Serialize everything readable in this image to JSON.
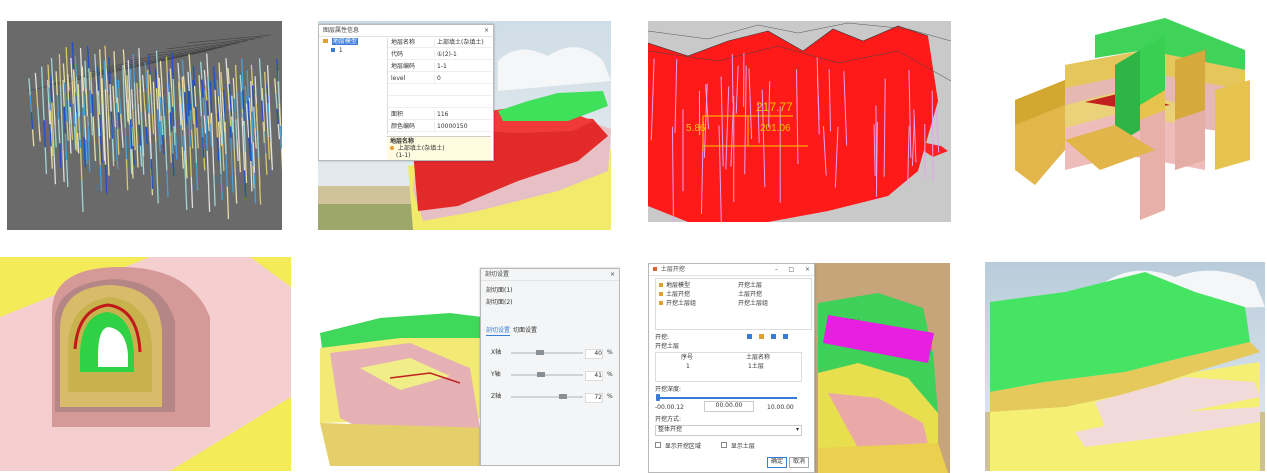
{
  "dialog_props": {
    "title": "图层属性信息",
    "close": "×",
    "tree": [
      "地层模型",
      "1"
    ],
    "rows": [
      {
        "k": "地层名称",
        "v": "上部填土(杂填土)"
      },
      {
        "k": "代码",
        "v": "①(2)-1"
      },
      {
        "k": "地层编码",
        "v": "1-1"
      },
      {
        "k": "level",
        "v": "0"
      },
      {
        "k": "",
        "v": ""
      },
      {
        "k": "",
        "v": ""
      },
      {
        "k": "面积",
        "v": "116"
      },
      {
        "k": "颜色编码",
        "v": "10000150"
      }
    ],
    "foot_title": "地层名称",
    "foot_text": "上部填土(杂填土)",
    "foot_sub": "(1-1)"
  },
  "measure": {
    "label_top": "217.77",
    "label_left": "5.86",
    "label_mid": "201.06"
  },
  "dialog_section": {
    "title": "剖切设置",
    "line1": "剖切面(1)",
    "line2": "剖切面(2)",
    "tab1": "剖切设置",
    "tab2": "切面设置",
    "axes": [
      {
        "label": "X轴",
        "value": "40",
        "unit": "%"
      },
      {
        "label": "Y轴",
        "value": "41",
        "unit": "%"
      },
      {
        "label": "Z轴",
        "value": "72",
        "unit": "%"
      }
    ],
    "close": "×"
  },
  "dialog_layers": {
    "title": "土层开挖",
    "win": [
      "–",
      "□",
      "×"
    ],
    "list": [
      {
        "name": "地层模型",
        "v": "开挖土层"
      },
      {
        "name": "土层开挖",
        "v": "土层开挖"
      },
      {
        "name": "开挖土层组",
        "v": "开挖土层组"
      }
    ],
    "sec_label": "开挖:",
    "sub_label": "开挖土层",
    "table_head": [
      "序号",
      "土层名称"
    ],
    "table_row": [
      "1",
      "1土层"
    ],
    "slider_label": "开挖深度:",
    "slider_min": "-00.00.12",
    "slider_mid": "00.00.00",
    "slider_max": "10.00.00",
    "select_label": "开挖方式:",
    "select_value": "整体开挖",
    "chk1": "显示开挖区域",
    "chk2": "显示土层",
    "ok": "确定",
    "cancel": "取消"
  }
}
